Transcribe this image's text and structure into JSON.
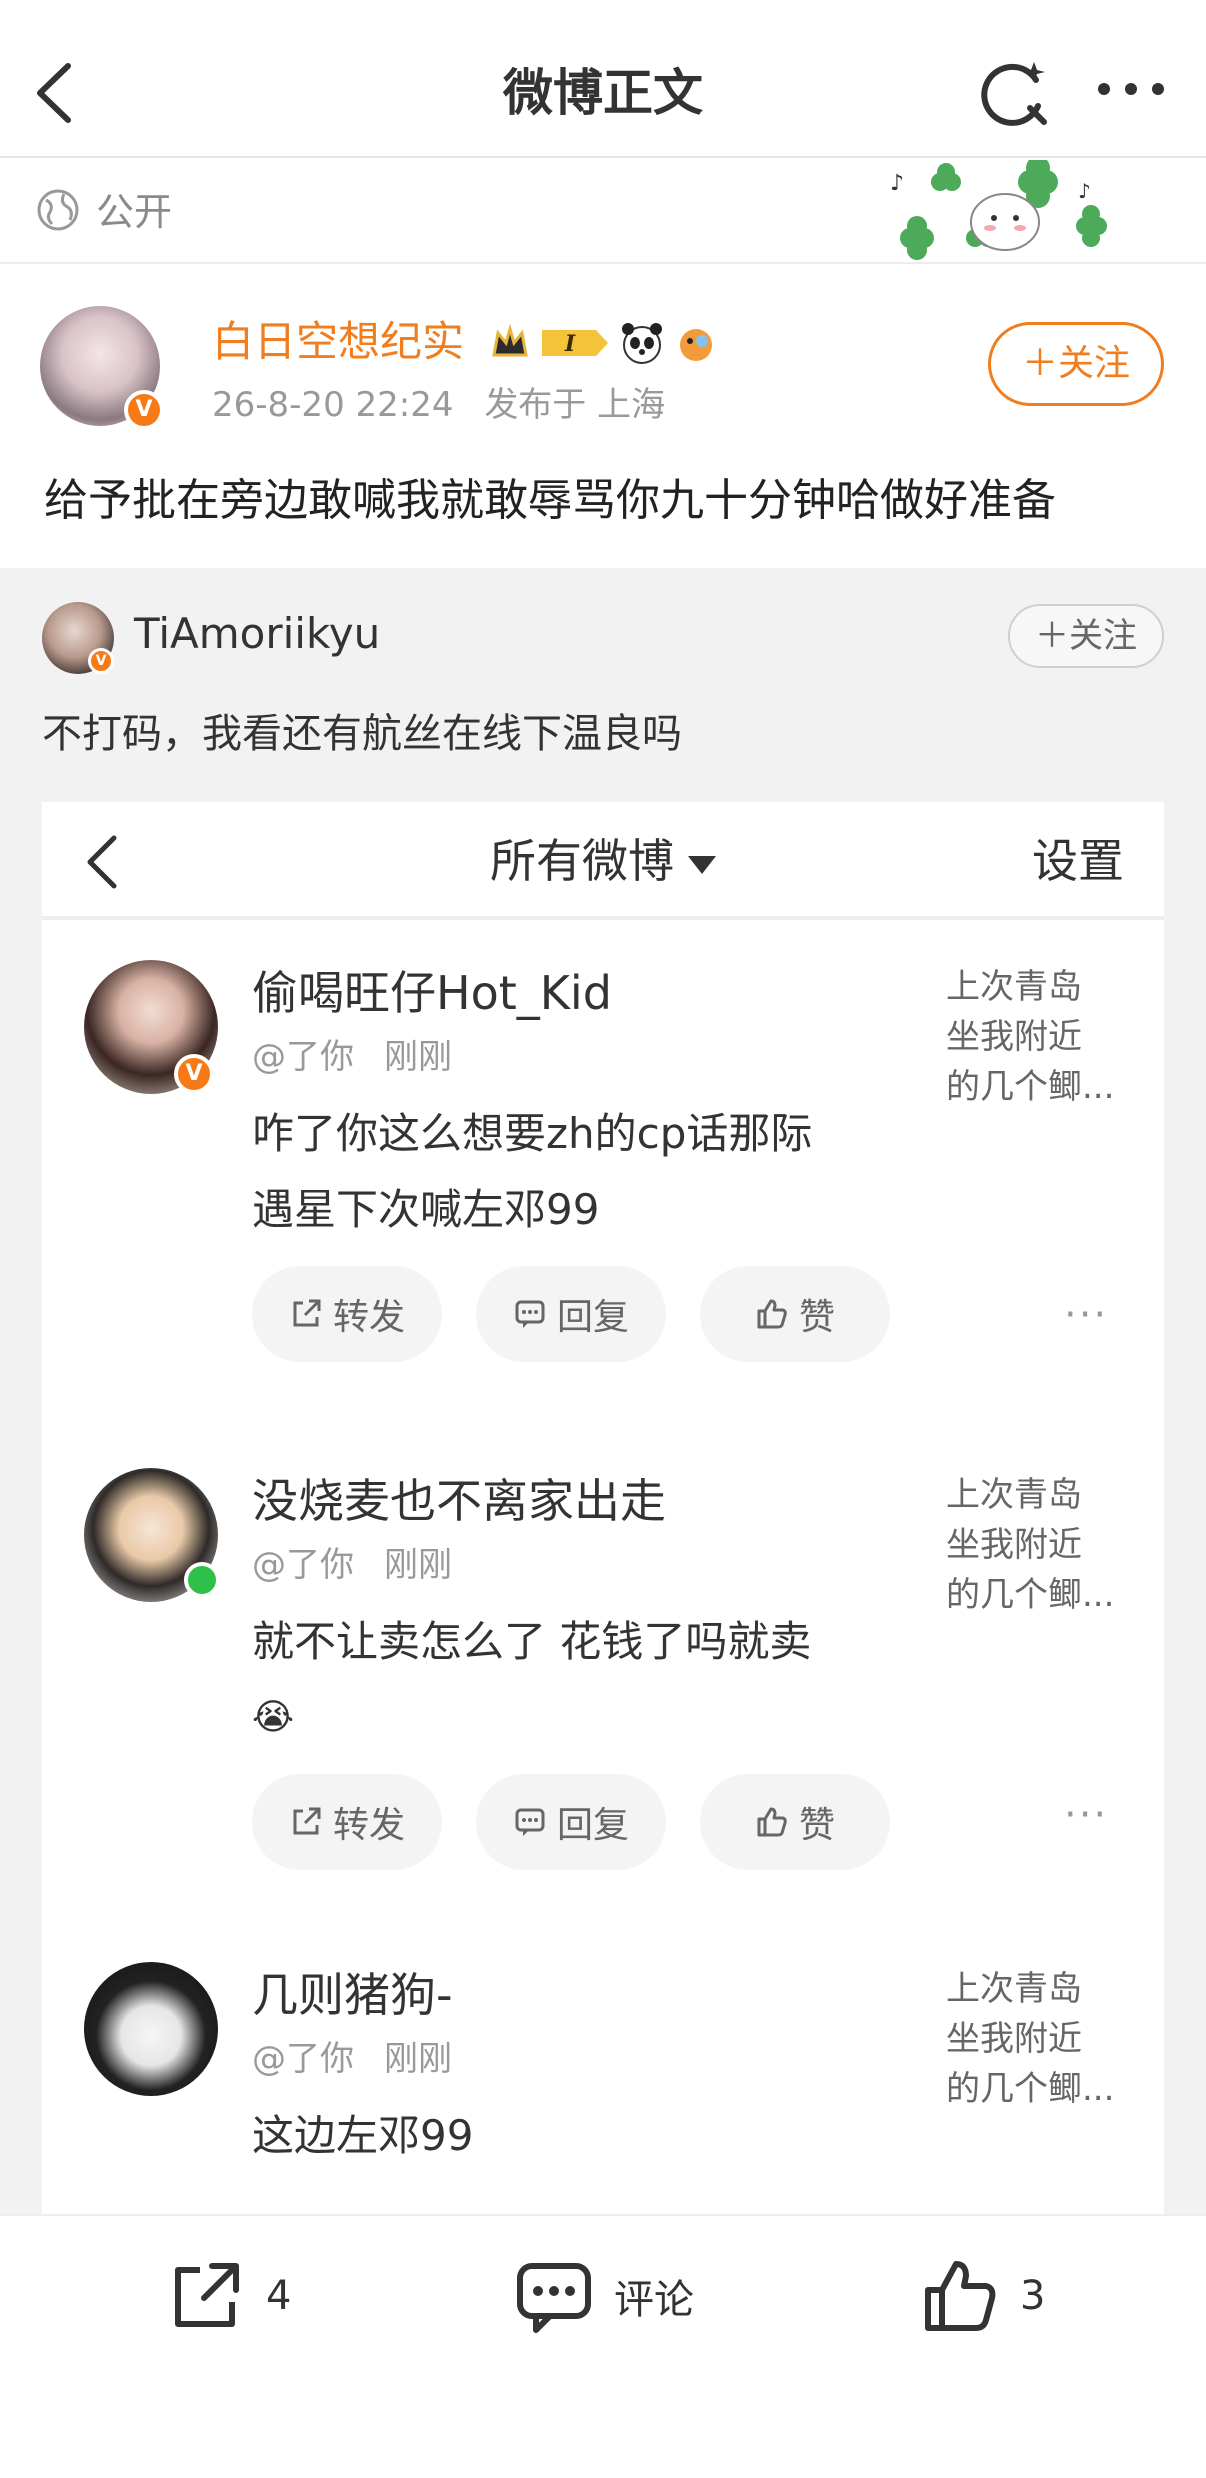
{
  "header": {
    "title": "微博正文"
  },
  "visibility": {
    "label": "公开"
  },
  "post": {
    "author": "白日空想纪实",
    "verified_badge": "V",
    "time": "26-8-20 22:24",
    "location": "发布于 上海",
    "follow_label": "＋关注",
    "text": "给予批在旁边敢喊我就敢辱骂你九十分钟哈做好准备",
    "badge_text": "I",
    "accent_color": "#f07e1e"
  },
  "repost": {
    "author": "TiAmoriikyu",
    "follow_label": "＋关注",
    "text": "不打码，我看还有航丝在线下温良吗"
  },
  "screenshot": {
    "title": "所有微博",
    "settings": "设置",
    "comments": [
      {
        "name": "偷喝旺仔Hot_Kid",
        "mention": "@了你",
        "time": "刚刚",
        "side": [
          "上次青岛",
          "坐我附近",
          "的几个鲫..."
        ],
        "text_lines": [
          "咋了你这么想要zh的cp话那际",
          "遇星下次喊左邓99"
        ],
        "actions": [
          "转发",
          "回复",
          "赞"
        ],
        "more": "···"
      },
      {
        "name": "没烧麦也不离家出走",
        "mention": "@了你",
        "time": "刚刚",
        "side": [
          "上次青岛",
          "坐我附近",
          "的几个鲫..."
        ],
        "text_lines": [
          "就不让卖怎么了 花钱了吗就卖",
          "😭"
        ],
        "actions": [
          "转发",
          "回复",
          "赞"
        ],
        "more": "···"
      },
      {
        "name": "几则猪狗-",
        "mention": "@了你",
        "time": "刚刚",
        "side": [
          "上次青岛",
          "坐我附近",
          "的几个鲫..."
        ],
        "text_lines": [
          "这边左邓99"
        ]
      }
    ]
  },
  "bottom": {
    "repost_count": "4",
    "comment_label": "评论",
    "like_count": "3"
  }
}
